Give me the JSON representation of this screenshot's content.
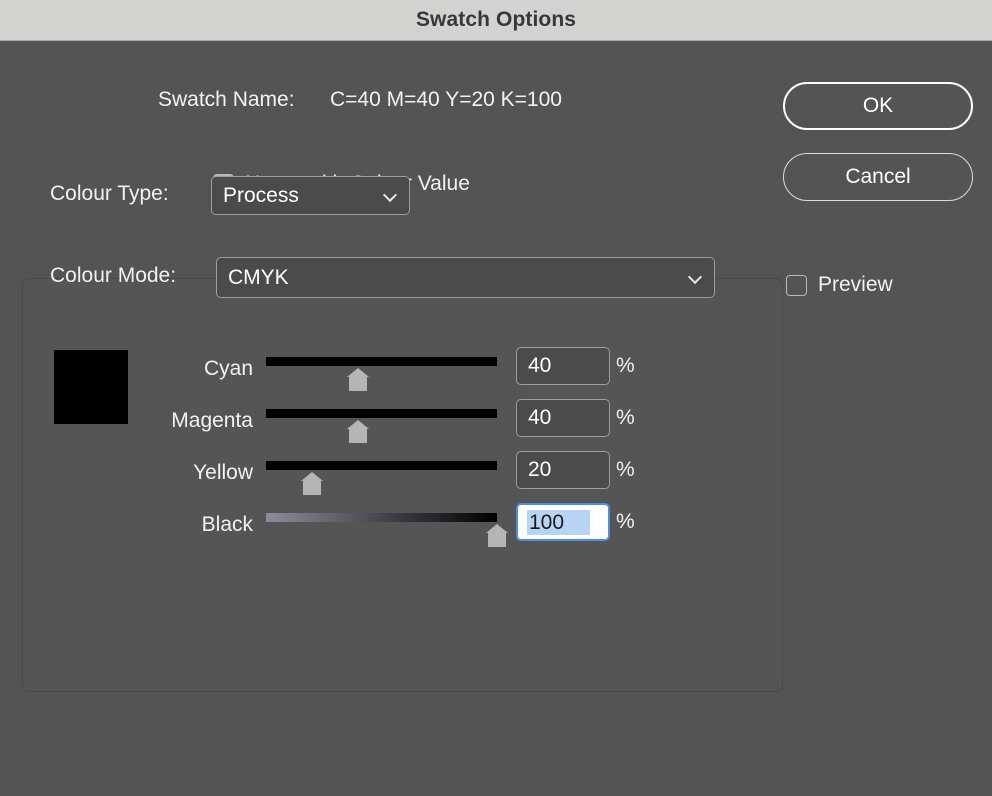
{
  "window": {
    "title": "Swatch Options"
  },
  "swatch_name": {
    "label": "Swatch Name:",
    "value": "C=40 M=40 Y=20 K=100"
  },
  "name_with_colour_value": {
    "label": "Name with Colour Value",
    "checked": true
  },
  "preview": {
    "label": "Preview",
    "checked": false
  },
  "colour_type": {
    "label": "Colour Type:",
    "value": "Process",
    "icon": "chevron-down-icon"
  },
  "colour_mode": {
    "label": "Colour Mode:",
    "value": "CMYK",
    "icon": "chevron-down-icon"
  },
  "colour_preview": {
    "hex": "#000000"
  },
  "sliders": [
    {
      "name": "Cyan",
      "value": "40",
      "unit": "%",
      "percent": 40,
      "track_start": "#000000",
      "track_end": "#000000",
      "focused": false
    },
    {
      "name": "Magenta",
      "value": "40",
      "unit": "%",
      "percent": 40,
      "track_start": "#000000",
      "track_end": "#000000",
      "focused": false
    },
    {
      "name": "Yellow",
      "value": "20",
      "unit": "%",
      "percent": 20,
      "track_start": "#000000",
      "track_end": "#000000",
      "focused": false
    },
    {
      "name": "Black",
      "value": "100",
      "unit": "%",
      "percent": 100,
      "track_start": "#8f8b99",
      "track_end": "#000000",
      "focused": true
    }
  ],
  "buttons": {
    "ok": "OK",
    "cancel": "Cancel"
  },
  "colors": {
    "dialog_background": "#545454",
    "titlebar_background": "#d2d2d0",
    "accent_focus": "#4a90e2",
    "selection": "#b7d4f2"
  }
}
